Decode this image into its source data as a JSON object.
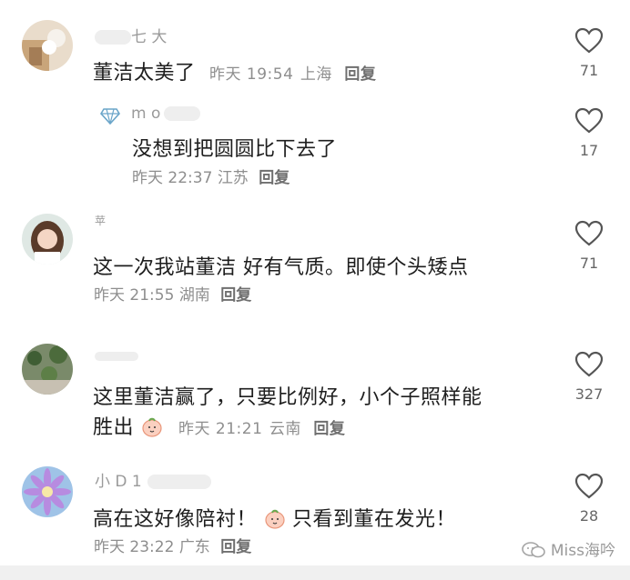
{
  "comments": [
    {
      "user": "七 大",
      "text": "董洁太美了",
      "time": "昨天 19:54",
      "location": "上海",
      "reply": "回复",
      "likes": "71"
    },
    {
      "user": "m o",
      "text": "没想到把圆圆比下去了",
      "time": "昨天 22:37",
      "location": "江苏",
      "reply": "回复",
      "likes": "17"
    },
    {
      "user": "苹",
      "text": "这一次我站董洁 好有气质。即使个头矮点",
      "time": "昨天 21:55",
      "location": "湖南",
      "reply": "回复",
      "likes": "71"
    },
    {
      "user": "",
      "text_line1": "这里董洁赢了，只要比例好，小个子照样能",
      "text_line2": "胜出",
      "time": "昨天 21:21",
      "location": "云南",
      "reply": "回复",
      "likes": "327"
    },
    {
      "user": "小 D 1",
      "text_part1": "高在这好像陪衬！",
      "text_part2": "只看到董在发光！",
      "time": "昨天 23:22",
      "location": "广东",
      "reply": "回复",
      "likes": "28"
    }
  ],
  "watermark": "Miss海吟",
  "icons": {
    "like": "heart-outline-icon",
    "badge": "diamond-icon",
    "emoji": "peach-emoji-icon",
    "watermark": "wechat-icon"
  },
  "colors": {
    "text": "#1e1e1e",
    "meta": "#8e8e8e",
    "background": "#ffffff"
  }
}
